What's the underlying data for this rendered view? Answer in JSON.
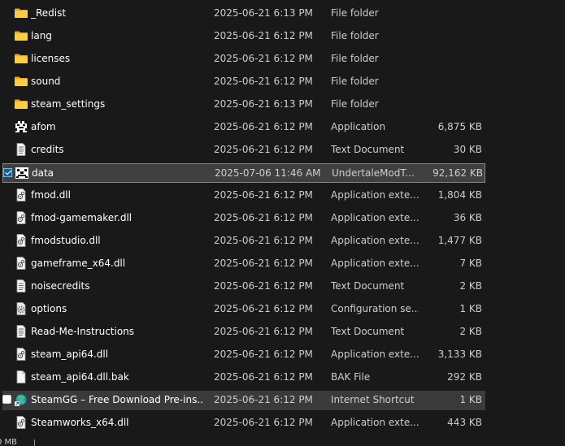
{
  "files": [
    {
      "name": "_Redist",
      "date": "2025-06-21 6:13 PM",
      "type": "File folder",
      "size": "",
      "icon": "folder-icon",
      "state": "normal"
    },
    {
      "name": "lang",
      "date": "2025-06-21 6:12 PM",
      "type": "File folder",
      "size": "",
      "icon": "folder-icon",
      "state": "normal"
    },
    {
      "name": "licenses",
      "date": "2025-06-21 6:12 PM",
      "type": "File folder",
      "size": "",
      "icon": "folder-icon",
      "state": "normal"
    },
    {
      "name": "sound",
      "date": "2025-06-21 6:12 PM",
      "type": "File folder",
      "size": "",
      "icon": "folder-icon",
      "state": "normal"
    },
    {
      "name": "steam_settings",
      "date": "2025-06-21 6:13 PM",
      "type": "File folder",
      "size": "",
      "icon": "folder-icon",
      "state": "normal"
    },
    {
      "name": "afom",
      "date": "2025-06-21 6:12 PM",
      "type": "Application",
      "size": "6,875 KB",
      "icon": "game-app-icon",
      "state": "normal"
    },
    {
      "name": "credits",
      "date": "2025-06-21 6:12 PM",
      "type": "Text Document",
      "size": "30 KB",
      "icon": "text-document-icon",
      "state": "normal"
    },
    {
      "name": "data",
      "date": "2025-07-06 11:46 AM",
      "type": "UndertaleModT...",
      "size": "92,162 KB",
      "icon": "undertale-mod-file-icon",
      "state": "selected"
    },
    {
      "name": "fmod.dll",
      "date": "2025-06-21 6:12 PM",
      "type": "Application exte...",
      "size": "1,804 KB",
      "icon": "dll-file-icon",
      "state": "normal"
    },
    {
      "name": "fmod-gamemaker.dll",
      "date": "2025-06-21 6:12 PM",
      "type": "Application exte...",
      "size": "36 KB",
      "icon": "dll-file-icon",
      "state": "normal"
    },
    {
      "name": "fmodstudio.dll",
      "date": "2025-06-21 6:12 PM",
      "type": "Application exte...",
      "size": "1,477 KB",
      "icon": "dll-file-icon",
      "state": "normal"
    },
    {
      "name": "gameframe_x64.dll",
      "date": "2025-06-21 6:12 PM",
      "type": "Application exte...",
      "size": "7 KB",
      "icon": "dll-file-icon",
      "state": "normal"
    },
    {
      "name": "noisecredits",
      "date": "2025-06-21 6:12 PM",
      "type": "Text Document",
      "size": "2 KB",
      "icon": "text-document-icon",
      "state": "normal"
    },
    {
      "name": "options",
      "date": "2025-06-21 6:12 PM",
      "type": "Configuration se...",
      "size": "1 KB",
      "icon": "config-file-icon",
      "state": "normal"
    },
    {
      "name": "Read-Me-Instructions",
      "date": "2025-06-21 6:12 PM",
      "type": "Text Document",
      "size": "2 KB",
      "icon": "text-document-icon",
      "state": "normal"
    },
    {
      "name": "steam_api64.dll",
      "date": "2025-06-21 6:12 PM",
      "type": "Application exte...",
      "size": "3,133 KB",
      "icon": "dll-file-icon",
      "state": "normal"
    },
    {
      "name": "steam_api64.dll.bak",
      "date": "2025-06-21 6:12 PM",
      "type": "BAK File",
      "size": "292 KB",
      "icon": "blank-file-icon",
      "state": "normal"
    },
    {
      "name": "SteamGG – Free Download Pre-ins...",
      "date": "2025-06-21 6:12 PM",
      "type": "Internet Shortcut",
      "size": "1 KB",
      "icon": "internet-shortcut-icon",
      "state": "hovered"
    },
    {
      "name": "Steamworks_x64.dll",
      "date": "2025-06-21 6:12 PM",
      "type": "Application exte...",
      "size": "443 KB",
      "icon": "dll-file-icon",
      "state": "normal"
    }
  ],
  "status_bar": {
    "selection_size": "0 MB"
  },
  "colors": {
    "background": "#191919",
    "selected_row": "#404040",
    "hovered_row": "#3a3a3a",
    "folder": "#f4c23b",
    "accent": "#4cc2ff"
  }
}
